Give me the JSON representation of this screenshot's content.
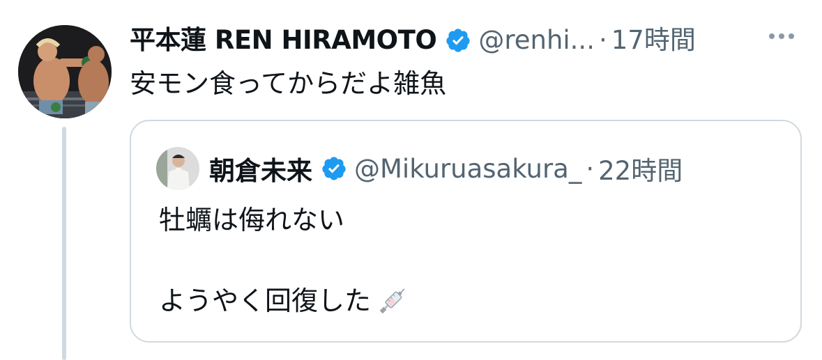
{
  "tweet": {
    "display_name": "平本蓮 REN HIRAMOTO",
    "handle": "@renhi...",
    "separator": "·",
    "time": "17時間",
    "text": "安モン食ってからだよ雑魚",
    "more_icon": "more-horizontal-icon",
    "verified_icon": "verified-badge-icon",
    "accent_color": "#1d9bf0"
  },
  "quote": {
    "display_name": "朝倉未来",
    "handle": "@Mikuruasakura_",
    "separator": "·",
    "time": "22時間",
    "line1": "牡蠣は侮れない",
    "line2": "ようやく回復した",
    "emoji_icon": "syringe-icon"
  }
}
